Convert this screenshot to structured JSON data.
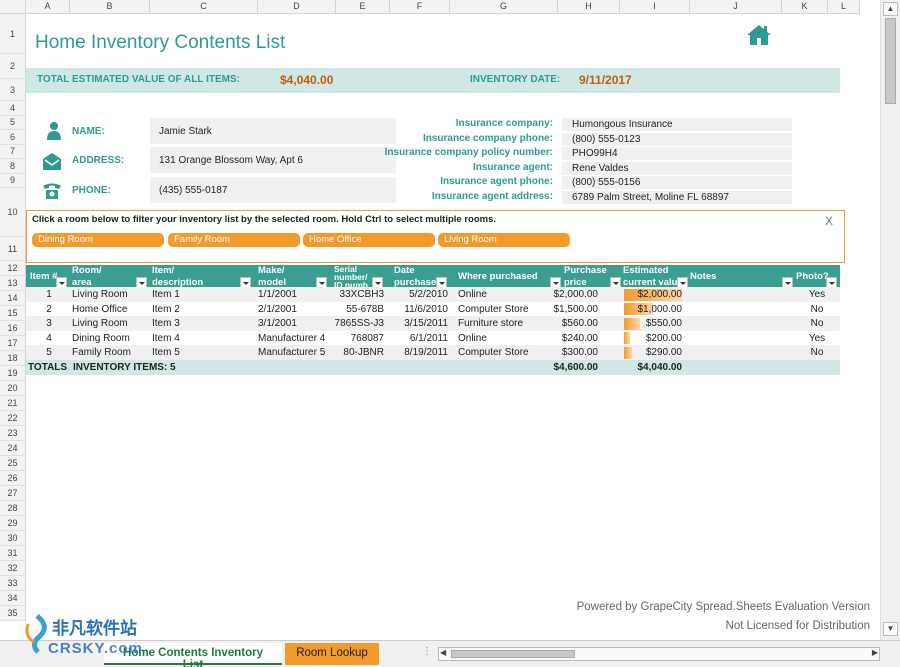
{
  "columns": [
    "A",
    "B",
    "C",
    "D",
    "E",
    "F",
    "G",
    "H",
    "I",
    "J",
    "K",
    "L"
  ],
  "rows": [
    "1",
    "2",
    "3",
    "4",
    "5",
    "6",
    "7",
    "8",
    "9",
    "10",
    "11",
    "12",
    "13",
    "14",
    "15",
    "16",
    "17",
    "18",
    "19",
    "20",
    "21",
    "22",
    "23",
    "24",
    "25",
    "26",
    "27",
    "28",
    "29",
    "30",
    "31",
    "32",
    "33",
    "34",
    "35"
  ],
  "title": "Home Inventory Contents List",
  "summary": {
    "total_label": "TOTAL ESTIMATED VALUE OF ALL ITEMS:",
    "total_value": "$4,040.00",
    "date_label": "INVENTORY DATE:",
    "date_value": "9/11/2017"
  },
  "owner": {
    "name_label": "NAME:",
    "name_value": "Jamie Stark",
    "address_label": "ADDRESS:",
    "address_value": "131 Orange Blossom Way, Apt 6",
    "phone_label": "PHONE:",
    "phone_value": "(435) 555-0187"
  },
  "insurance": [
    {
      "label": "Insurance company:",
      "value": "Humongous Insurance"
    },
    {
      "label": "Insurance company phone:",
      "value": "(800) 555-0123"
    },
    {
      "label": "Insurance company policy number:",
      "value": "PHO99H4"
    },
    {
      "label": "Insurance agent:",
      "value": "Rene Valdes"
    },
    {
      "label": "Insurance agent phone:",
      "value": "(800) 555-0156"
    },
    {
      "label": "Insurance agent address:",
      "value": "6789 Palm Street, Moline FL 68897"
    }
  ],
  "filter": {
    "instructions": "Click a room below to filter your inventory list by the selected room. Hold Ctrl to select multiple rooms.",
    "close": "X",
    "rooms": [
      "Dining Room",
      "Family Room",
      "Home Office",
      "Living Room"
    ]
  },
  "table": {
    "headers": [
      "Item #",
      "Room/\narea",
      "Item/\ndescription",
      "Make/\nmodel",
      "Serial\nnumber/\nID numb",
      "Date\npurchased",
      "Where purchased",
      "Purchase\nprice",
      "Estimated\ncurrent valu",
      "Notes",
      "Photo?"
    ],
    "rows": [
      {
        "item": "1",
        "room": "Living Room",
        "desc": "Item 1",
        "model": "1/1/2001",
        "serial": "33XCBH3",
        "date": "5/2/2010",
        "where": "Online",
        "price": "$2,000.00",
        "value": "$2,000.00",
        "value_fraction": 1.0,
        "notes": "",
        "photo": "Yes"
      },
      {
        "item": "2",
        "room": "Home Office",
        "desc": "Item 2",
        "model": "2/1/2001",
        "serial": "55-678B",
        "date": "11/6/2010",
        "where": "Computer Store",
        "price": "$1,500.00",
        "value": "$1,000.00",
        "value_fraction": 0.5,
        "notes": "",
        "photo": "No"
      },
      {
        "item": "3",
        "room": "Living Room",
        "desc": "Item 3",
        "model": "3/1/2001",
        "serial": "7865SS-J3",
        "date": "3/15/2011",
        "where": "Furniture store",
        "price": "$560.00",
        "value": "$550.00",
        "value_fraction": 0.275,
        "notes": "",
        "photo": "No"
      },
      {
        "item": "4",
        "room": "Dining Room",
        "desc": "Item 4",
        "model": "Manufacturer 4",
        "serial": "768087",
        "date": "6/1/2011",
        "where": "Online",
        "price": "$240.00",
        "value": "$200.00",
        "value_fraction": 0.1,
        "notes": "",
        "photo": "Yes"
      },
      {
        "item": "5",
        "room": "Family Room",
        "desc": "Item 5",
        "model": "Manufacturer 5",
        "serial": "80-JBNR",
        "date": "8/19/2011",
        "where": "Computer Store",
        "price": "$300.00",
        "value": "$290.00",
        "value_fraction": 0.145,
        "notes": "",
        "photo": "No"
      }
    ],
    "totals": {
      "label": "TOTALS",
      "count_label": "INVENTORY ITEMS: 5",
      "price": "$4,600.00",
      "value": "$4,040.00"
    }
  },
  "footer": {
    "line1": "Powered by GrapeCity Spread.Sheets Evaluation Version",
    "line2": "Not Licensed for Distribution"
  },
  "tabs": {
    "active": "Home Contents Inventory List",
    "other": "Room Lookup"
  },
  "watermark": {
    "line1": "非凡软件站",
    "line2": "CRSKY.com"
  },
  "colors": {
    "teal": "#2e9b93",
    "header_teal": "#3a9e93",
    "band": "#cfe8e6",
    "orange": "#f39a2c",
    "value_red": "#c55a11"
  }
}
